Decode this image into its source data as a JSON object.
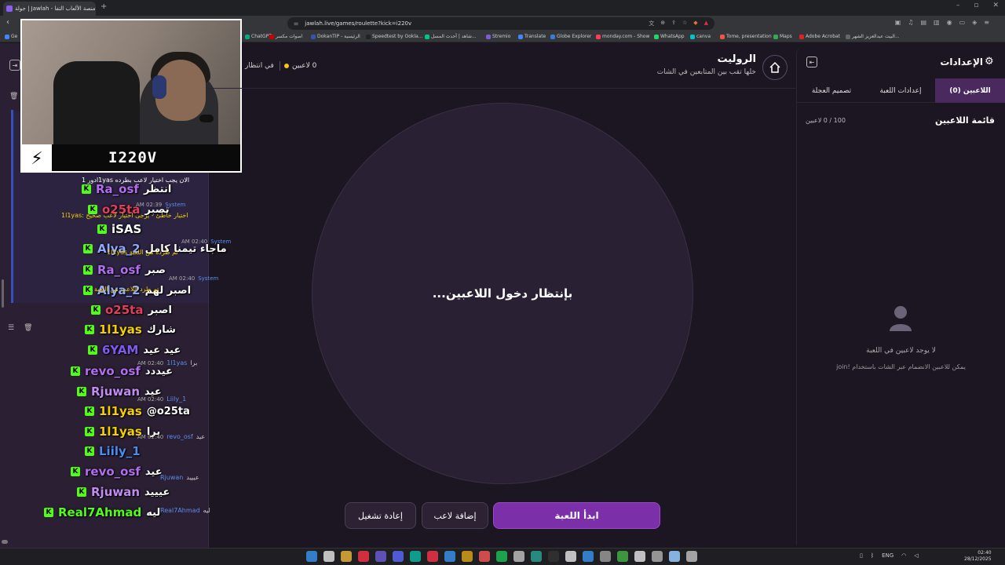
{
  "browser": {
    "tab_title": "جولة | Jawlah - منصة الألعاب التفا...",
    "url": "jawlah.live/games/roulette?kick=i220v",
    "bookmarks": [
      {
        "label": "Ge",
        "color": "#4285f4"
      },
      {
        "label": "ChatGPT",
        "color": "#10a37f"
      },
      {
        "label": "اصوات مكسر",
        "color": "#cc0000"
      },
      {
        "label": "DokanTIP - الرئيسية",
        "color": "#3355aa"
      },
      {
        "label": "Speedtest by Ookla...",
        "color": "#222"
      },
      {
        "label": "شاهد | أحدث المسل...",
        "color": "#00c58e"
      },
      {
        "label": "Stremio",
        "color": "#7b5bd6"
      },
      {
        "label": "Translate",
        "color": "#4285f4"
      },
      {
        "label": "Globe Explorer",
        "color": "#3a7bd5"
      },
      {
        "label": "monday.com - Show",
        "color": "#ff3d57"
      },
      {
        "label": "WhatsApp",
        "color": "#25d366"
      },
      {
        "label": "canva",
        "color": "#00c4cc"
      },
      {
        "label": "Tome, presentation",
        "color": "#e54"
      },
      {
        "label": "Maps",
        "color": "#34a853"
      },
      {
        "label": "Adobe Acrobat",
        "color": "#d22"
      },
      {
        "label": "البيت عبدالعزيز الشهر...",
        "color": "#666"
      }
    ]
  },
  "webcam": {
    "channel_name": "I220V",
    "logo": "⚡"
  },
  "chat": {
    "overlay_top": "دور 1l1yas الان يجب اختيار لاعب بطرده",
    "system_label": "System",
    "messages": [
      {
        "user": "Ra_osf",
        "color": "#b26cf0",
        "text": "انتظر"
      },
      {
        "user": "o25ta",
        "color": "#e0405a",
        "text": "تصبر"
      },
      {
        "user": "iSAS",
        "color": "#ffffff",
        "text": ""
      },
      {
        "user": "Alya_2",
        "color": "#8fa8ff",
        "text": "ماجاء تيمنا كامل"
      },
      {
        "user": "Ra_osf",
        "color": "#b26cf0",
        "text": "صبر"
      },
      {
        "user": "Alya_2",
        "color": "#8fa8ff",
        "text": "اصبر لهم"
      },
      {
        "user": "o25ta",
        "color": "#e0405a",
        "text": "اصبر"
      },
      {
        "user": "1l1yas",
        "color": "#f5d000",
        "text": "شارك"
      },
      {
        "user": "6YAM",
        "color": "#7f5af0",
        "text": "عيد عيد"
      },
      {
        "user": "revo_osf",
        "color": "#b26cf0",
        "text": "عيددد"
      },
      {
        "user": "Rjuwan",
        "color": "#c08cf0",
        "text": "عيد"
      },
      {
        "user": "1l1yas",
        "color": "#f5d000",
        "text": "@o25ta"
      },
      {
        "user": "1l1yas",
        "color": "#f5d000",
        "text": "برا"
      },
      {
        "user": "Liily_1",
        "color": "#4a8cf0",
        "text": ""
      },
      {
        "user": "revo_osf",
        "color": "#b26cf0",
        "text": "عيد"
      },
      {
        "user": "Rjuwan",
        "color": "#c08cf0",
        "text": "عيييد"
      },
      {
        "user": "Real7Ahmad",
        "color": "#53fc18",
        "text": "ليه"
      }
    ],
    "system_lines": [
      {
        "time": "AM 02:39",
        "text": "1l1yas: اختيار خاطئ - يرجى اختيار لاعب صحيح"
      },
      {
        "time": "AM 02:40",
        "text": "1l1yas تم طرده من اللعبة"
      },
      {
        "time": "AM 02:40",
        "text": "تم طرد اللاعب من اللعبة"
      }
    ],
    "side_lines": [
      {
        "time": "AM 02:40",
        "user": "1l1yas",
        "text": "برا"
      },
      {
        "time": "AM 02:40",
        "user": "Liily_1",
        "text": ""
      },
      {
        "time": "AM 02:40",
        "user": "revo_osf",
        "text": "عيد"
      },
      {
        "time": "",
        "user": "Rjuwan",
        "text": "عيييد"
      },
      {
        "time": "",
        "user": "Real7Ahmad",
        "text": "ليه"
      }
    ]
  },
  "header": {
    "title": "الروليت",
    "subtitle": "خلها تقب بين المتابعين في الشات",
    "status_count": "0 لاعبين",
    "status_wait": "في انتظار"
  },
  "wheel": {
    "waiting_text": "بإنتظار دخول اللاعبين..."
  },
  "buttons": {
    "start": "ابدأ اللعبة",
    "add_player": "إضافة لاعب",
    "reset": "إعادة تشغيل"
  },
  "settings": {
    "title": "الإعدادات",
    "tabs": [
      "اللاعبين (0)",
      "إعدادات اللعبة",
      "تصميم العجلة"
    ],
    "players_list_title": "قائمة اللاعبين",
    "players_count": "100 / 0 لاعبين",
    "empty_title": "لا يوجد لاعبين في اللعبة",
    "empty_sub": "يمكن للاعبين الانضمام عبر الشات باستخدام !join"
  },
  "taskbar": {
    "lang": "ENG",
    "time": "02:40",
    "date": "28/12/2025"
  }
}
